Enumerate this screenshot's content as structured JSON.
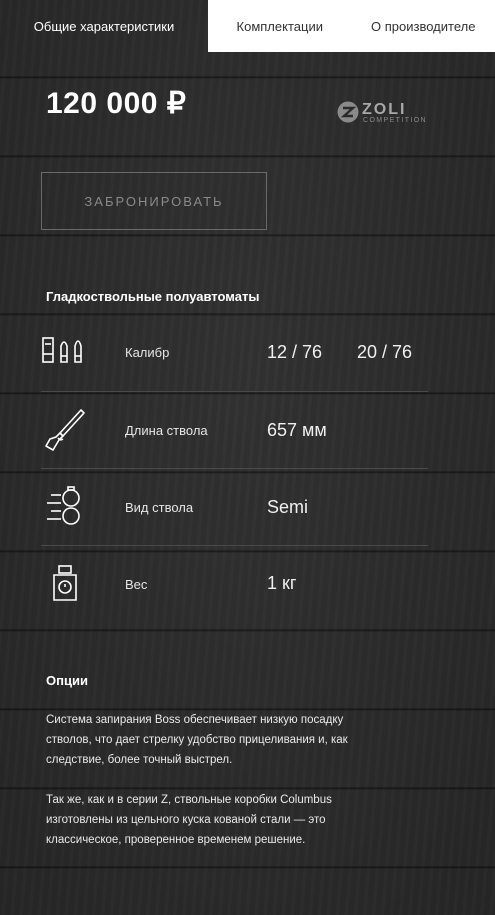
{
  "tabs": [
    {
      "label": "Общие характеристики",
      "active": true
    },
    {
      "label": "Комплектации",
      "active": false
    },
    {
      "label": "О производителе",
      "active": false
    }
  ],
  "price": "120 000 ₽",
  "brand": {
    "name": "ZOLI",
    "sub": "COMPETITION"
  },
  "reserve_button": "ЗАБРОНИРОВАТЬ",
  "section_title": "Гладкоствольные полуавтоматы",
  "specs": [
    {
      "label": "Калибр",
      "values": [
        "12 / 76",
        "20 / 76"
      ],
      "icon": "cartridges-icon"
    },
    {
      "label": "Длина ствола",
      "values": [
        "657 мм"
      ],
      "icon": "rifle-icon"
    },
    {
      "label": "Вид ствола",
      "values": [
        "Semi"
      ],
      "icon": "barrel-type-icon"
    },
    {
      "label": "Вес",
      "values": [
        "1 кг"
      ],
      "icon": "weight-icon"
    }
  ],
  "options": {
    "title": "Опции",
    "paragraphs": [
      "Система запирания Boss обеспечивает низкую посадку стволов, что дает стрелку удобство прицеливания и, как следствие, более точный выстрел.",
      "Так же, как и в серии Z,  ствольные коробки Columbus изготовлены из цельного куска кованой стали — это классическое, проверенное временем решение."
    ]
  },
  "colors": {
    "background": "#2b2b2b",
    "tab_bar": "#ffffff",
    "text": "#ffffff"
  }
}
